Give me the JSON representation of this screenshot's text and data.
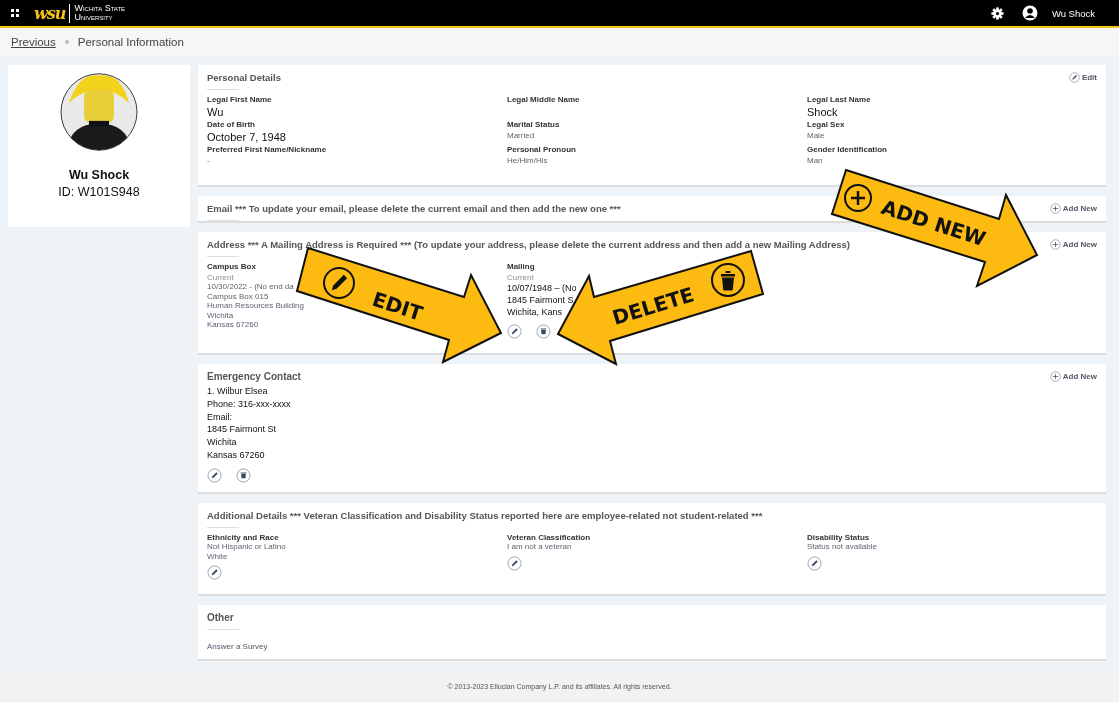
{
  "header": {
    "logo_mark": "wsu",
    "logo_lines": [
      "Wichita State",
      "University"
    ],
    "user_name": "Wu Shock"
  },
  "breadcrumb": {
    "previous": "Previous",
    "current": "Personal Information"
  },
  "profile": {
    "name": "Wu Shock",
    "id": "ID: W101S948"
  },
  "sections": [
    {
      "kind": "personal",
      "title": "Personal Details",
      "rule": true,
      "action": {
        "kind": "edit",
        "label": "Edit"
      },
      "fields": [
        {
          "label": "Legal First Name",
          "value": "Wu",
          "large": true
        },
        {
          "label": "Legal Middle Name"
        },
        {
          "label": "Legal Last Name",
          "value": "Shock",
          "large": true
        },
        {
          "label": "Date of Birth",
          "value": "October 7, 1948",
          "large": true
        },
        {
          "label": "Marital Status",
          "value": "Married",
          "large": false
        },
        {
          "label": "Legal Sex",
          "value": "Male",
          "large": false
        },
        {
          "label": "Preferred First Name/Nickname",
          "value": "-",
          "large": false
        },
        {
          "label": "Personal Pronoun",
          "value": "He/Him/His",
          "large": false
        },
        {
          "label": "Gender Identification",
          "value": "Man",
          "large": false
        }
      ]
    },
    {
      "kind": "email",
      "title": "Email *** To update your email, please delete the current email and then add the new one ***",
      "rule": true,
      "action": {
        "kind": "add",
        "label": "Add New"
      }
    },
    {
      "kind": "address",
      "title": "Address *** A Mailing Address is Required *** (To update your address, please delete the current address and then add a new Mailing Address)",
      "rule": true,
      "action": {
        "kind": "add",
        "label": "Add New"
      },
      "addresses": [
        {
          "title": "Campus Box",
          "status": "Current",
          "emphasis": false,
          "lines": [
            "10/30/2022 - (No end da",
            "Campus Box 015",
            "Human Resources Building",
            "Wichita",
            "Kansas 67260"
          ],
          "editable": false,
          "deletable": false
        },
        {
          "title": "Mailing",
          "status": "Current",
          "emphasis": true,
          "lines": [
            "10/07/1948 – (No",
            "1845 Fairmont S",
            "Wichita, Kans"
          ],
          "editable": true,
          "deletable": true
        }
      ]
    },
    {
      "kind": "contact",
      "title": "Emergency Contact",
      "rule": false,
      "action": {
        "kind": "add",
        "label": "Add New"
      },
      "lines": [
        "1. Wilbur Elsea",
        "Phone: 316-xxx-xxxx",
        "Email:",
        "1845 Fairmont St",
        "Wichita",
        "Kansas 67260"
      ],
      "editable": true,
      "deletable": true
    },
    {
      "kind": "additional",
      "title": "Additional Details *** Veteran Classification and Disability Status reported here are employee-related not student-related ***",
      "rule": true,
      "columns": [
        {
          "label": "Ethnicity and Race",
          "lines": [
            "Not Hispanic or Latino",
            "White"
          ],
          "editable": true
        },
        {
          "label": "Veteran Classification",
          "lines": [
            "I am not a veteran"
          ],
          "editable": true
        },
        {
          "label": "Disability Status",
          "lines": [
            "Status not available"
          ],
          "editable": true
        }
      ]
    },
    {
      "kind": "other",
      "title": "Other",
      "rule": true,
      "links": [
        "Answer a Survey"
      ]
    }
  ],
  "footer": "© 2013-2023 Ellucian Company L.P. and its affiliates. All rights reserved.",
  "callouts": [
    {
      "kind": "edit",
      "label": "EDIT"
    },
    {
      "kind": "delete",
      "label": "DELETE"
    },
    {
      "kind": "add",
      "label": "ADD NEW"
    }
  ]
}
